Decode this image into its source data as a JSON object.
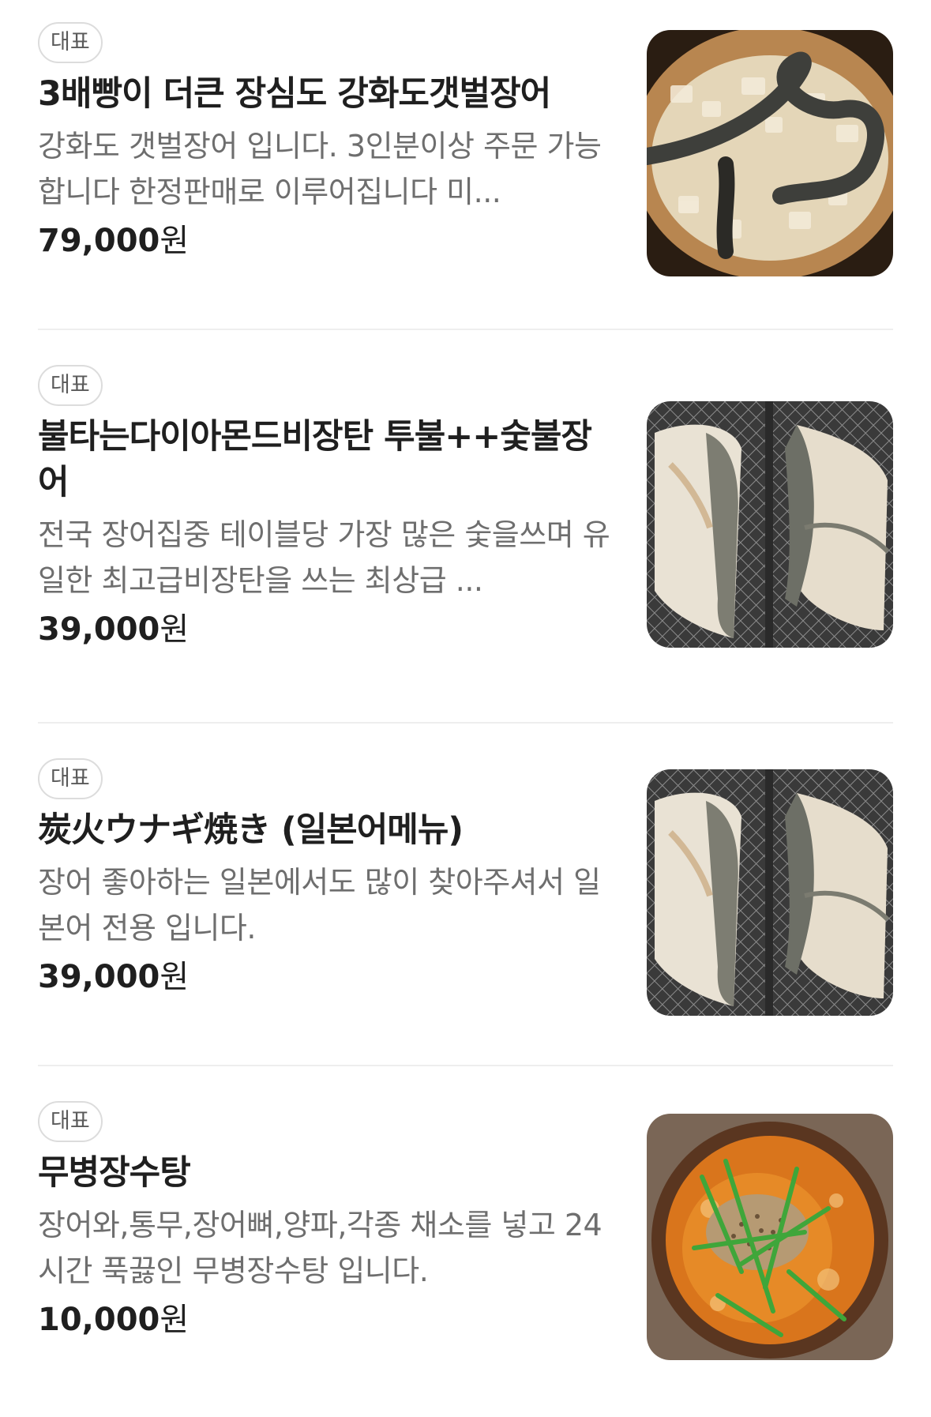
{
  "menu": {
    "items": [
      {
        "badge": "대표",
        "title": "3배빵이 더큰 장심도 강화도갯벌장어",
        "description": "강화도 갯벌장어 입니다. 3인분이상 주문 가능합니다 한정판매로 이루어집니다 미...",
        "price": "79,000",
        "currency": "원",
        "image": "eel-on-ice-photo"
      },
      {
        "badge": "대표",
        "title": "불타는다이아몬드비장탄 투불++숯불장어",
        "description": "전국 장어집중 테이블당 가장 많은 숯을쓰며 유일한 최고급비장탄을 쓰는 최상급 ...",
        "price": "39,000",
        "currency": "원",
        "image": "grilled-eel-photo"
      },
      {
        "badge": "대표",
        "title": "炭火ウナギ焼き (일본어메뉴)",
        "description": "장어 좋아하는 일본에서도 많이 찾아주셔서 일본어 전용 입니다.",
        "price": "39,000",
        "currency": "원",
        "image": "grilled-eel-photo"
      },
      {
        "badge": "대표",
        "title": "무병장수탕",
        "description": "장어와,통무,장어뼈,양파,각종 채소를 넣고 24시간 푹끓인 무병장수탕 입니다.",
        "price": "10,000",
        "currency": "원",
        "image": "eel-soup-photo"
      }
    ]
  },
  "colors": {
    "text_primary": "#1f1f1f",
    "text_secondary": "#6e6e6e",
    "badge_border": "#dcdcdc",
    "divider": "#eeeeee"
  }
}
